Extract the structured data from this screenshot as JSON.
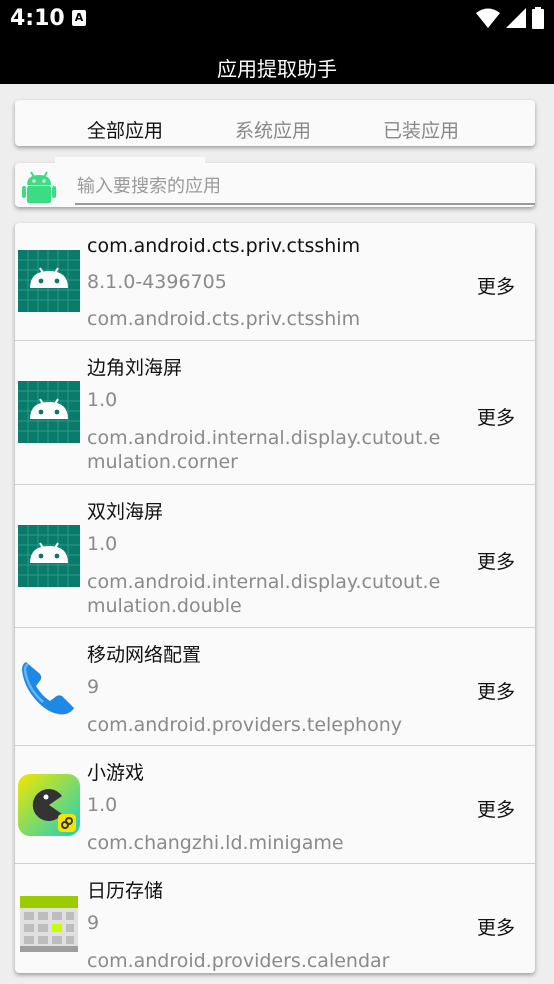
{
  "status": {
    "time": "4:10",
    "badge": "A"
  },
  "app": {
    "title": "应用提取助手"
  },
  "tabs": [
    {
      "label": "全部应用",
      "active": true
    },
    {
      "label": "系统应用",
      "active": false
    },
    {
      "label": "已装应用",
      "active": false
    }
  ],
  "search": {
    "placeholder": "输入要搜索的应用"
  },
  "apps": [
    {
      "name": "com.android.cts.priv.ctsshim",
      "version": "8.1.0-4396705",
      "package": "com.android.cts.priv.ctsshim",
      "icon": "android-default-icon",
      "more": "更多"
    },
    {
      "name": "边角刘海屏",
      "version": "1.0",
      "package": "com.android.internal.display.cutout.emulation.corner",
      "icon": "android-default-icon",
      "more": "更多"
    },
    {
      "name": "双刘海屏",
      "version": "1.0",
      "package": "com.android.internal.display.cutout.emulation.double",
      "icon": "android-default-icon",
      "more": "更多"
    },
    {
      "name": "移动网络配置",
      "version": "9",
      "package": "com.android.providers.telephony",
      "icon": "phone-icon",
      "more": "更多"
    },
    {
      "name": "小游戏",
      "version": "1.0",
      "package": "com.changzhi.ld.minigame",
      "icon": "minigame-icon",
      "more": "更多"
    },
    {
      "name": "日历存储",
      "version": "9",
      "package": "com.android.providers.calendar",
      "icon": "calendar-storage-icon",
      "more": "更多"
    }
  ]
}
